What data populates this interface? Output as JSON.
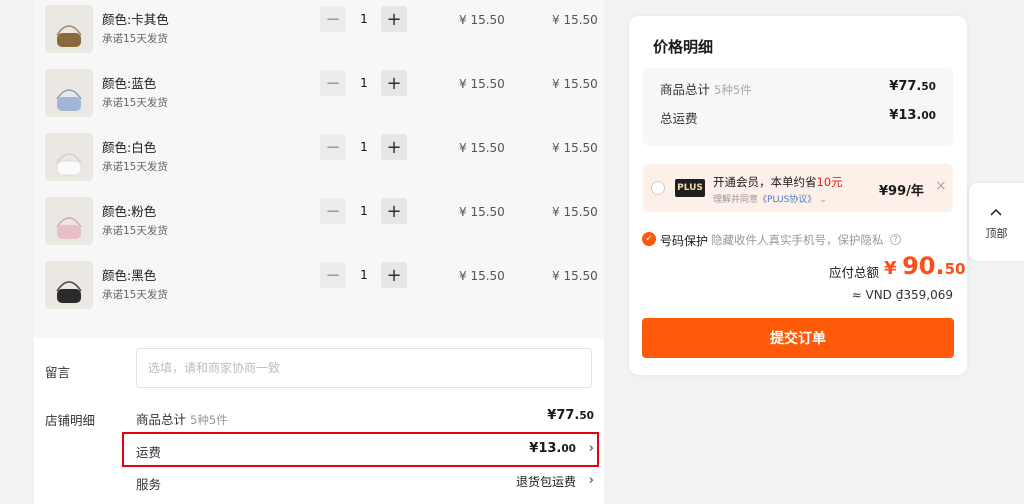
{
  "cart": {
    "items": [
      {
        "name": "颜色:卡其色",
        "ship": "承诺15天发货",
        "qty": "1",
        "unit_price": "¥ 15.50",
        "subtotal": "¥ 15.50",
        "color": "#8a6a3a"
      },
      {
        "name": "颜色:蓝色",
        "ship": "承诺15天发货",
        "qty": "1",
        "unit_price": "¥ 15.50",
        "subtotal": "¥ 15.50",
        "color": "#9fb6d6"
      },
      {
        "name": "颜色:白色",
        "ship": "承诺15天发货",
        "qty": "1",
        "unit_price": "¥ 15.50",
        "subtotal": "¥ 15.50",
        "color": "#f2f2f0"
      },
      {
        "name": "颜色:粉色",
        "ship": "承诺15天发货",
        "qty": "1",
        "unit_price": "¥ 15.50",
        "subtotal": "¥ 15.50",
        "color": "#e7c0c6"
      },
      {
        "name": "颜色:黑色",
        "ship": "承诺15天发货",
        "qty": "1",
        "unit_price": "¥ 15.50",
        "subtotal": "¥ 15.50",
        "color": "#2b2b2b"
      }
    ]
  },
  "remark": {
    "label": "留言",
    "placeholder": "选填，请和商家协商一致"
  },
  "store_detail": {
    "label": "店铺明细",
    "goods_label": "商品总计",
    "goods_sub": "5种5件",
    "goods_currency": "¥",
    "goods_int": "77.",
    "goods_dec": "50",
    "shipping_label": "运费",
    "shipping_currency": "¥",
    "shipping_int": "13.",
    "shipping_dec": "00",
    "service_label": "服务",
    "service_value": "退货包运费"
  },
  "price_card": {
    "title": "价格明细",
    "goods_label": "商品总计",
    "goods_sub": "5种5件",
    "goods_currency": "¥",
    "goods_int": "77.",
    "goods_dec": "50",
    "shipping_label": "总运费",
    "shipping_currency": "¥",
    "shipping_int": "13.",
    "shipping_dec": "00",
    "plus_logo": "PLUS",
    "plus_text_pre": "开通会员，本单约省",
    "plus_text_amount": "10元",
    "plus_sub_pre": "理解并同意",
    "plus_sub_link": "《PLUS协议》",
    "plus_price": "¥99/年",
    "protect_title": "号码保护",
    "protect_desc": "隐藏收件人真实手机号，保护隐私",
    "total_label": "应付总额",
    "total_currency": "¥",
    "total_int": "90.",
    "total_dec": "50",
    "vnd": "≈ VND ₫359,069",
    "submit": "提交订单"
  },
  "back_top": {
    "label": "顶部"
  },
  "colors": {
    "accent": "#ff5a0a",
    "price_red": "#ff4e1b",
    "highlight": "#e60012"
  }
}
